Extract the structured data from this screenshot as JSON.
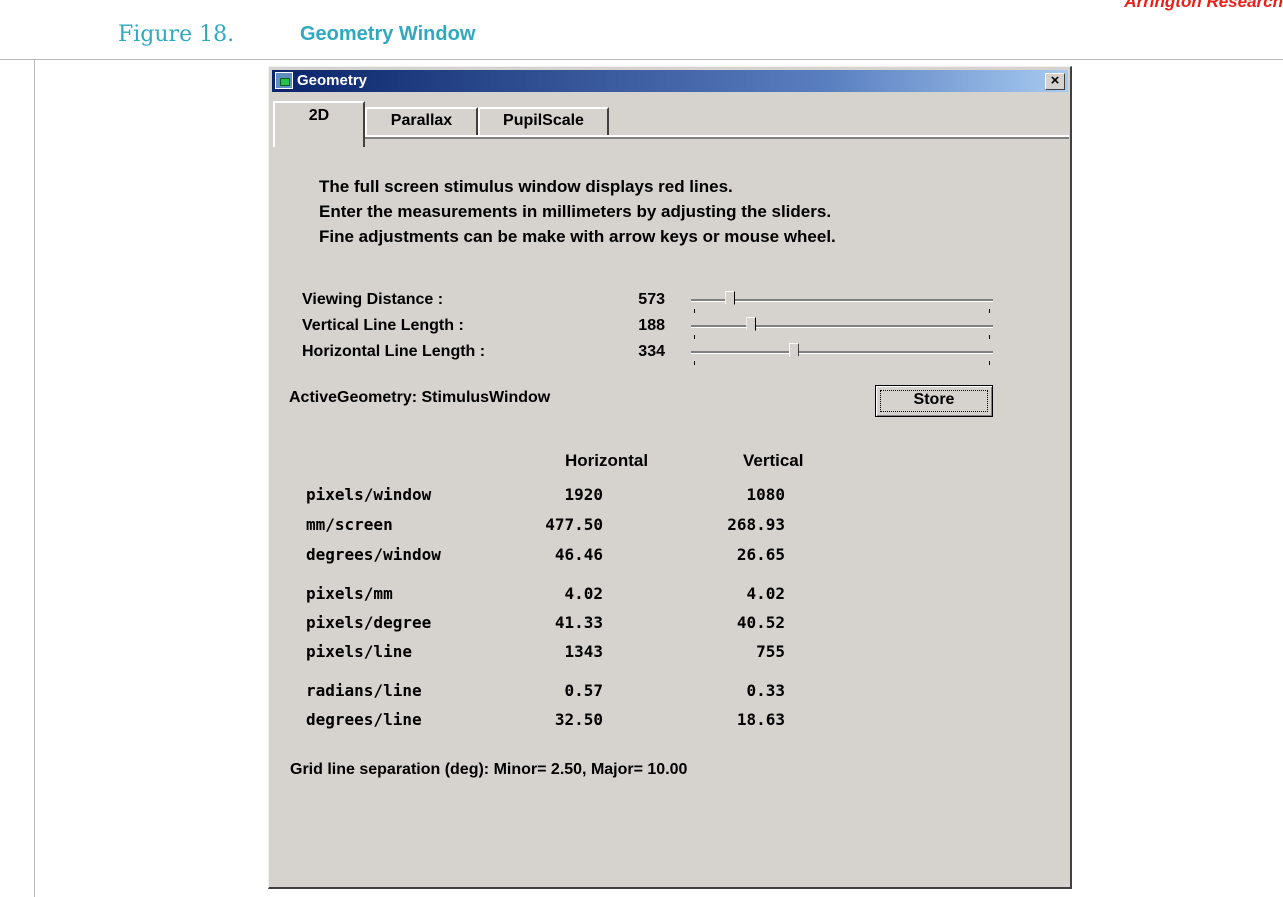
{
  "document": {
    "header_brand": "Arrington Research",
    "figure_number": "Figure 18.",
    "figure_title": "Geometry Window"
  },
  "window": {
    "title": "Geometry",
    "close_label": "×",
    "tabs": [
      {
        "label": "2D",
        "active": true
      },
      {
        "label": "Parallax",
        "active": false
      },
      {
        "label": "PupilScale",
        "active": false
      }
    ]
  },
  "instructions": [
    "The full screen stimulus window displays red lines.",
    "Enter the measurements in millimeters by adjusting the sliders.",
    "Fine adjustments can be make with arrow keys or mouse wheel."
  ],
  "sliders": [
    {
      "label": "Viewing Distance :",
      "value": "573",
      "position": 0.13
    },
    {
      "label": "Vertical Line Length :",
      "value": "188",
      "position": 0.2
    },
    {
      "label": "Horizontal Line Length :",
      "value": "334",
      "position": 0.34
    }
  ],
  "active_geometry": "ActiveGeometry: StimulusWindow",
  "store_label": "Store",
  "table": {
    "headers": {
      "horizontal": "Horizontal",
      "vertical": "Vertical"
    },
    "rows": [
      {
        "label": "pixels/window",
        "h": "1920",
        "v": "1080"
      },
      {
        "label": "mm/screen",
        "h": "477.50",
        "v": "268.93"
      },
      {
        "label": "degrees/window",
        "h": "46.46",
        "v": "26.65"
      },
      {
        "label": "pixels/mm",
        "h": "4.02",
        "v": "4.02"
      },
      {
        "label": "pixels/degree",
        "h": "41.33",
        "v": "40.52"
      },
      {
        "label": "pixels/line",
        "h": "1343",
        "v": "755"
      },
      {
        "label": "radians/line",
        "h": "0.57",
        "v": "0.33"
      },
      {
        "label": "degrees/line",
        "h": "32.50",
        "v": "18.63"
      }
    ]
  },
  "grid_separation": "Grid line separation (deg): Minor= 2.50,  Major= 10.00",
  "colors": {
    "brand": "#e8201a",
    "caption": "#2fa9c0",
    "window_bg": "#d6d3ce",
    "titlebar": "#0a246a"
  }
}
